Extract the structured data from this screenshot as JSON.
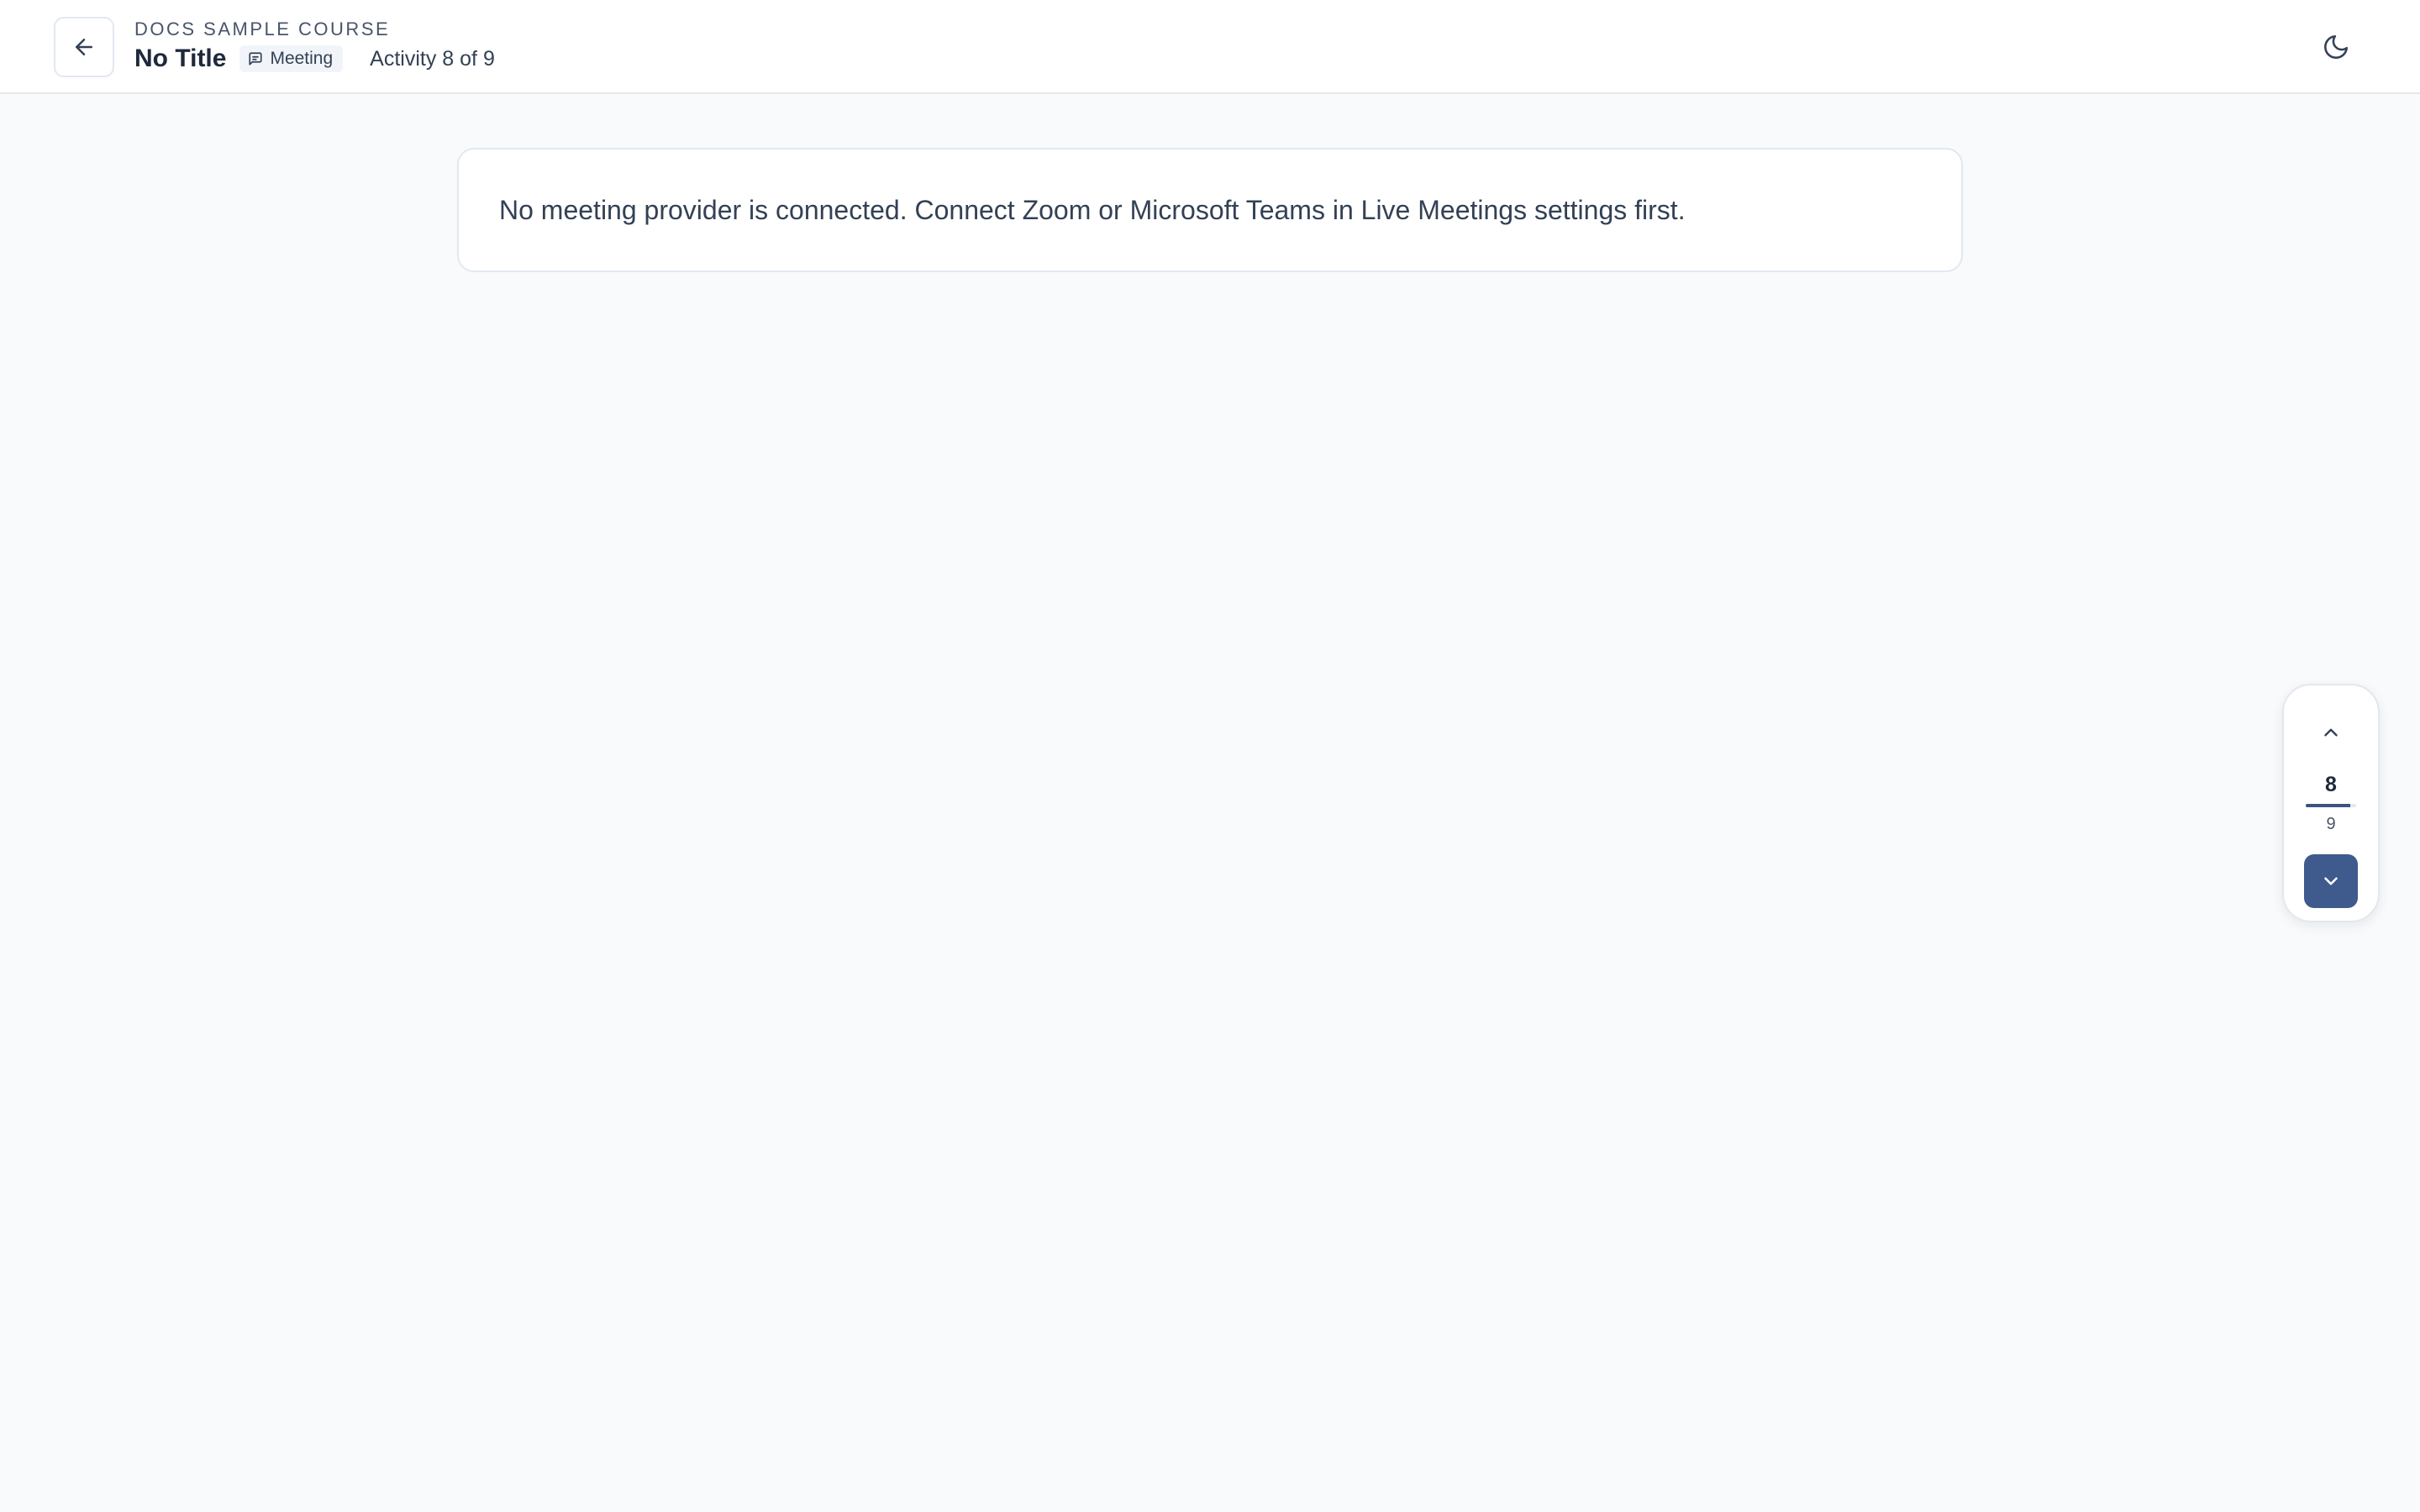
{
  "header": {
    "back_icon": "arrow-left-icon",
    "course_name": "DOCS SAMPLE COURSE",
    "activity_title": "No Title",
    "type_badge": {
      "icon": "message-square-icon",
      "label": "Meeting"
    },
    "activity_counter": "Activity 8 of 9",
    "theme_toggle_icon": "moon-icon"
  },
  "notice": {
    "message": "No meeting provider is connected. Connect Zoom or Microsoft Teams in Live Meetings settings first."
  },
  "pager": {
    "up_icon": "chevron-up-icon",
    "current": "8",
    "total": "9",
    "progress_fraction": 0.889,
    "down_icon": "chevron-down-icon"
  },
  "colors": {
    "page_background": "#f8fafc",
    "accent": "#3f5a8c",
    "text": "#334155",
    "border": "#e2e8f0"
  }
}
